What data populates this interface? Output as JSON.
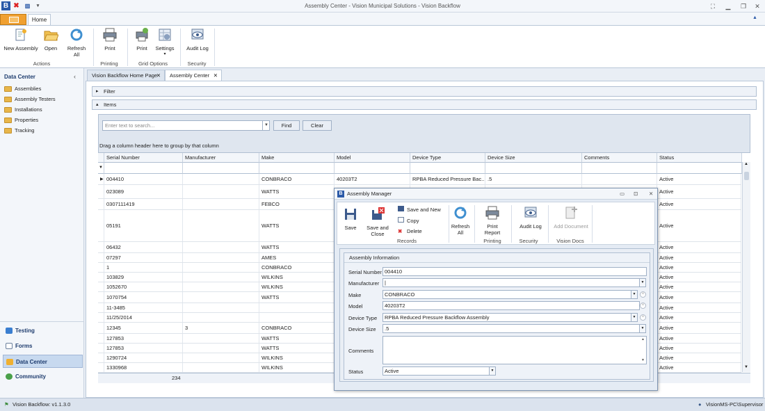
{
  "window": {
    "title": "Assembly Center - Vision Municipal Solutions - Vision Backflow"
  },
  "ribbon": {
    "home_tab": "Home",
    "buttons": [
      {
        "label": "New Assembly",
        "icon": "new-assembly-icon"
      },
      {
        "label": "Open",
        "icon": "folder-open-icon"
      },
      {
        "label": "Refresh All",
        "icon": "refresh-icon"
      },
      {
        "label": "Print",
        "icon": "printer-icon"
      },
      {
        "label": "Print",
        "icon": "grid-print-icon"
      },
      {
        "label": "Settings",
        "icon": "grid-settings-icon"
      },
      {
        "label": "Audit Log",
        "icon": "audit-log-icon"
      }
    ],
    "groups": [
      "Actions",
      "Printing",
      "Grid Options",
      "Security"
    ]
  },
  "sidebar": {
    "title": "Data Center",
    "items": [
      "Assemblies",
      "Assembly Testers",
      "Installations",
      "Properties",
      "Tracking"
    ],
    "nav": [
      "Testing",
      "Forms",
      "Data Center",
      "Community"
    ]
  },
  "tabs": [
    "Vision Backflow Home Page",
    "Assembly Center"
  ],
  "filter": {
    "label": "Filter"
  },
  "items": {
    "label": "Items",
    "search_placeholder": "Enter text to search...",
    "find": "Find",
    "clear": "Clear",
    "group_hint": "Drag a column header here to group by that column",
    "count": "234"
  },
  "grid": {
    "columns": [
      "Serial Number",
      "Manufacturer",
      "Make",
      "Model",
      "Device Type",
      "Device Size",
      "Comments",
      "Status"
    ],
    "rows": [
      {
        "serial": "004410",
        "manufacturer": "",
        "make": "CONBRACO",
        "model": "40203T2",
        "type": "RPBA Reduced Pressure Bac...",
        "size": ".5",
        "status": "Active"
      },
      {
        "serial": "023089",
        "manufacturer": "",
        "make": "WATTS",
        "model": "",
        "type": "",
        "size": "",
        "status": "Active"
      },
      {
        "serial": "0307111419",
        "manufacturer": "",
        "make": "FEBCO",
        "model": "",
        "type": "",
        "size": "",
        "status": "Active"
      },
      {
        "serial": "05191",
        "manufacturer": "",
        "make": "WATTS",
        "model": "",
        "type": "",
        "size": "",
        "status": "Active"
      },
      {
        "serial": "06432",
        "manufacturer": "",
        "make": "WATTS",
        "model": "",
        "type": "",
        "size": "",
        "status": "Active"
      },
      {
        "serial": "07297",
        "manufacturer": "",
        "make": "AMES",
        "model": "",
        "type": "",
        "size": "",
        "status": "Active"
      },
      {
        "serial": "1",
        "manufacturer": "",
        "make": "CONBRACO",
        "model": "",
        "type": "",
        "size": "",
        "status": "Active"
      },
      {
        "serial": "103829",
        "manufacturer": "",
        "make": "WILKINS",
        "model": "",
        "type": "",
        "size": "",
        "status": "Active"
      },
      {
        "serial": "1052670",
        "manufacturer": "",
        "make": "WILKINS",
        "model": "",
        "type": "",
        "size": "",
        "status": "Active"
      },
      {
        "serial": "1070754",
        "manufacturer": "",
        "make": "WATTS",
        "model": "",
        "type": "",
        "size": "",
        "status": "Active"
      },
      {
        "serial": "11-3485",
        "manufacturer": "",
        "make": "",
        "model": "",
        "type": "",
        "size": "",
        "status": "Active"
      },
      {
        "serial": "11/25/2014",
        "manufacturer": "",
        "make": "",
        "model": "",
        "type": "",
        "size": "",
        "status": "Active"
      },
      {
        "serial": "12345",
        "manufacturer": "3",
        "make": "CONBRACO",
        "model": "",
        "type": "",
        "size": "",
        "status": "Active"
      },
      {
        "serial": "127853",
        "manufacturer": "",
        "make": "WATTS",
        "model": "",
        "type": "",
        "size": "",
        "status": "Active"
      },
      {
        "serial": "127853",
        "manufacturer": "",
        "make": "WATTS",
        "model": "",
        "type": "",
        "size": "",
        "status": "Active"
      },
      {
        "serial": "1290724",
        "manufacturer": "",
        "make": "WILKINS",
        "model": "",
        "type": "",
        "size": "",
        "status": "Active"
      },
      {
        "serial": "1330968",
        "manufacturer": "",
        "make": "WILKINS",
        "model": "",
        "type": "",
        "size": "",
        "status": "Active"
      }
    ]
  },
  "dialog": {
    "title": "Assembly Manager",
    "buttons": {
      "save": "Save",
      "save_close": "Save and Close",
      "save_new": "Save and New",
      "copy": "Copy",
      "delete": "Delete",
      "refresh": "Refresh All",
      "print": "Print Report",
      "audit": "Audit Log",
      "add_doc": "Add Document"
    },
    "groups": [
      "Records",
      "Printing",
      "Security",
      "Vision Docs"
    ],
    "section": "Assembly Information",
    "labels": [
      "Serial Number",
      "Manufacturer",
      "Make",
      "Model",
      "Device Type",
      "Device Size",
      "Comments",
      "Status"
    ],
    "values": {
      "serial": "004410",
      "manufacturer": "|",
      "make": "CONBRACO",
      "model": "40203T2",
      "type": "RPBA Reduced Pressure Backflow Assembly",
      "size": ".5",
      "comments": "",
      "status": "Active"
    }
  },
  "status": {
    "version": "Vision Backflow: v1.1.3.0",
    "user": "VisionMS-PC\\Supervisor"
  }
}
